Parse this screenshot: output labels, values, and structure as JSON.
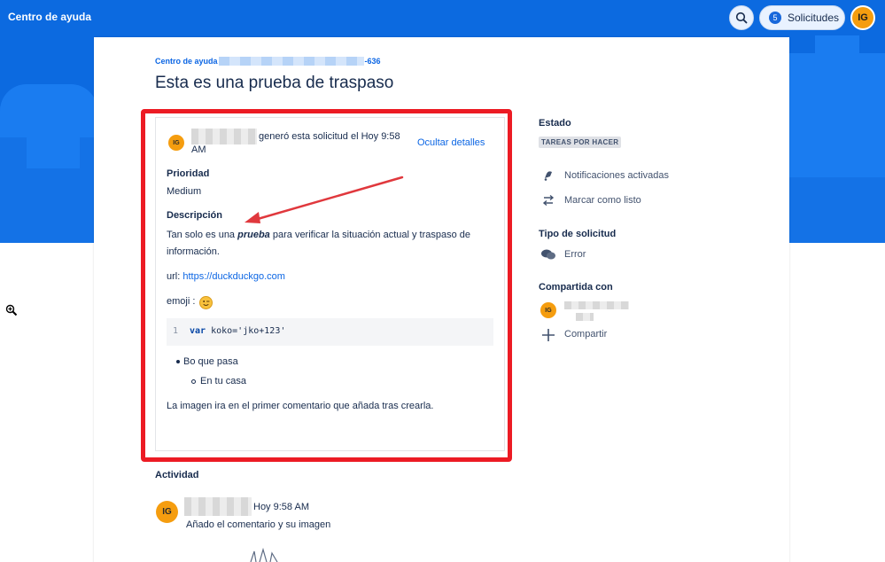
{
  "header": {
    "title": "Centro de ayuda",
    "requests_count": "5",
    "requests_label": "Solicitudes",
    "user_initials": "IG"
  },
  "breadcrumb": {
    "root": "Centro de ayuda",
    "suffix": "-636"
  },
  "request": {
    "title": "Esta es una prueba de traspaso",
    "reporter_initials": "IG",
    "created_text": "generó esta solicitud el Hoy 9:58",
    "created_text_cont": "AM",
    "hide_details": "Ocultar detalles",
    "priority_label": "Prioridad",
    "priority_value": "Medium",
    "description_label": "Descripción",
    "desc_line1_pre": "Tan solo es una ",
    "desc_line1_bold": "prueba",
    "desc_line1_post": " para verificar la situación actual y traspaso de",
    "desc_line2": "información.",
    "url_label": "url: ",
    "url_value": "https://duckduckgo.com",
    "emoji_label": "emoji :",
    "code_line_number": "1",
    "code_keyword": "var",
    "code_rest": " koko='jko+123'",
    "bullet1": "Bo que pasa",
    "bullet2": "En tu casa",
    "footer_text": "La imagen ira en el primer comentario que añada tras crearla."
  },
  "sidebar": {
    "status_label": "Estado",
    "status_value": "TAREAS POR HACER",
    "notifications": "Notificaciones activadas",
    "mark_done": "Marcar como listo",
    "request_type_label": "Tipo de solicitud",
    "request_type_value": "Error",
    "shared_label": "Compartida con",
    "shared_initials": "IG",
    "share_action": "Compartir"
  },
  "activity": {
    "label": "Actividad",
    "author_initials": "IG",
    "time": "Hoy 9:58 AM",
    "comment": "Añado el comentario y su imagen"
  },
  "colors": {
    "brand_blue": "#0c6ae0",
    "annotation_red": "#ec1b24",
    "avatar_orange": "#f59d0f",
    "link_blue": "#0c66e4"
  }
}
